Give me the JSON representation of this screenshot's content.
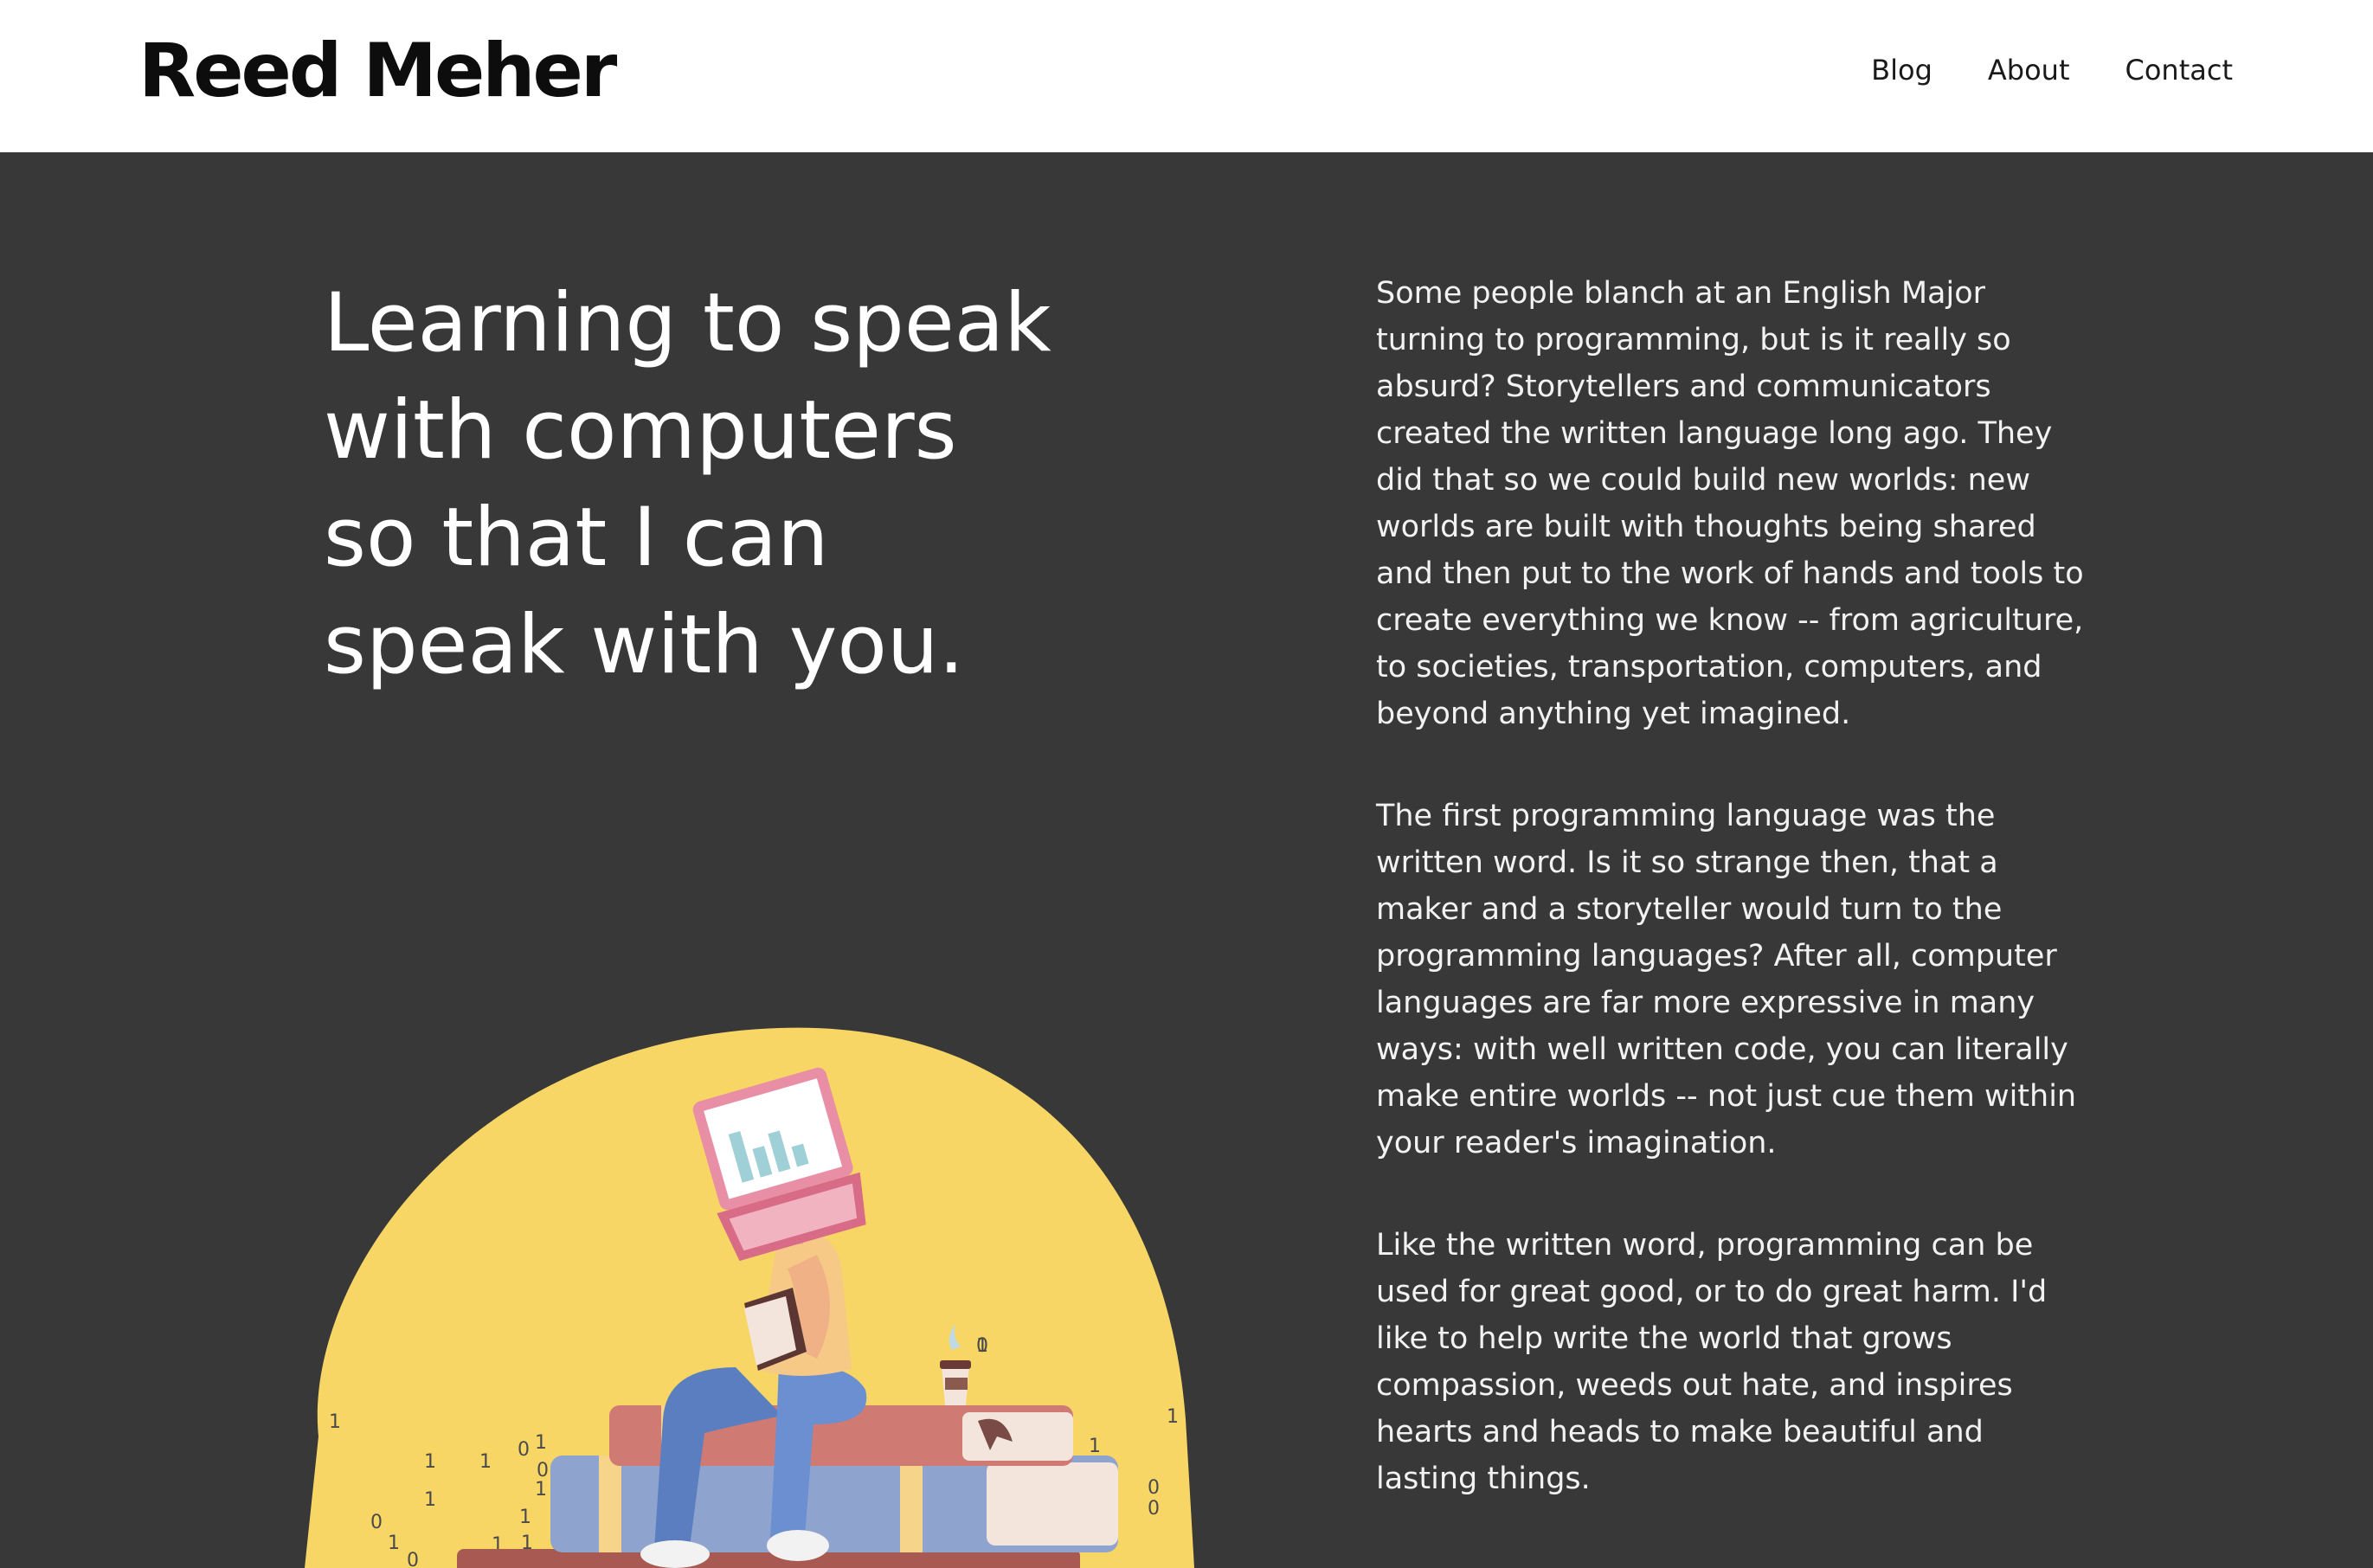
{
  "header": {
    "logo": "Reed Meher",
    "nav": [
      "Blog",
      "About",
      "Contact"
    ]
  },
  "hero": {
    "headline_lines": [
      "Learning to speak",
      "with computers",
      "so that I can",
      "speak with you."
    ]
  },
  "body": {
    "paragraphs": [
      "Some people blanch at an English Major turning to programming, but is it really so absurd? Storytellers and communicators created the written language long ago. They did that so we could build new worlds: new worlds are built with thoughts being shared and then put to the work of hands and tools to create everything we know -- from agriculture, to societies, transportation, computers, and beyond anything yet imagined.",
      "The first programming language was the written word.  Is it so strange then, that a maker and a storyteller would turn to the programming languages? After all, computer languages are far more expressive in many ways: with well written code, you can literally make entire worlds -- not just cue them within your reader's imagination.",
      "Like the written word, programming can be used for great good, or to do great harm. I'd like to help write the world that grows compassion, weeds out hate, and inspires hearts and heads to make beautiful and lasting things."
    ]
  },
  "illustration": {
    "binary_digits": [
      "1",
      "1",
      "1",
      "0",
      "1",
      "0",
      "1",
      "1",
      "0",
      "1",
      "1",
      "1",
      "0",
      "1",
      "1",
      "0",
      "1",
      "0",
      "0"
    ],
    "colors": {
      "blob": "#f7d666",
      "book_red": "#cf7a73",
      "book_blue": "#8fa3cf",
      "person_shirt": "#f6c987",
      "person_pants": "#5a7ec0",
      "laptop": "#e88fa6"
    }
  },
  "theme": {
    "background": "#383838",
    "header_bg": "#ffffff",
    "text": "#ffffff"
  }
}
